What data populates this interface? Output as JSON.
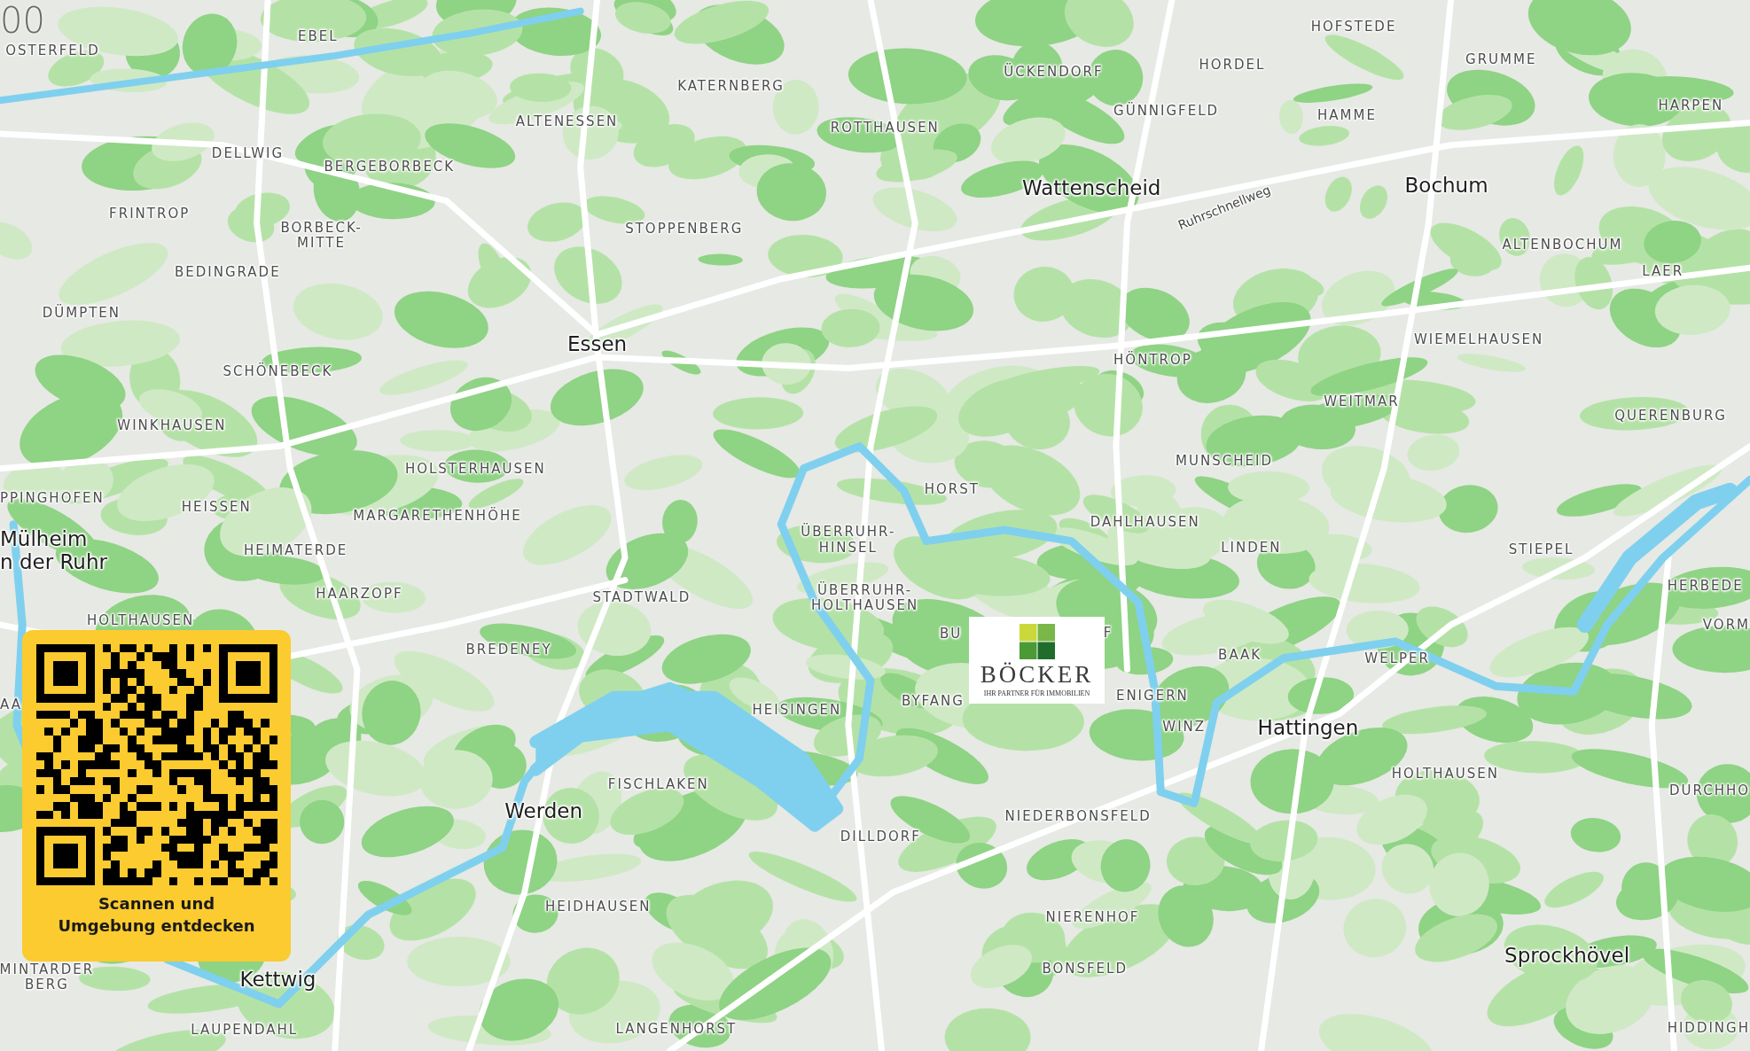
{
  "map": {
    "labels": [
      {
        "text": "00",
        "kind": "scale"
      },
      {
        "text": "OSTERFELD",
        "kind": "district"
      },
      {
        "text": "EBEL",
        "kind": "district"
      },
      {
        "text": "KATERNBERG",
        "kind": "district"
      },
      {
        "text": "ÜCKENDORF",
        "kind": "district"
      },
      {
        "text": "HORDEL",
        "kind": "district"
      },
      {
        "text": "HOFSTEDE",
        "kind": "district"
      },
      {
        "text": "GRUMME",
        "kind": "district"
      },
      {
        "text": "HARPEN",
        "kind": "district"
      },
      {
        "text": "ALTENESSEN",
        "kind": "district"
      },
      {
        "text": "ROTTHAUSEN",
        "kind": "district"
      },
      {
        "text": "GÜNNIGFELD",
        "kind": "district"
      },
      {
        "text": "HAMME",
        "kind": "district"
      },
      {
        "text": "DELLWIG",
        "kind": "district"
      },
      {
        "text": "BERGEBORBECK",
        "kind": "district"
      },
      {
        "text": "Wattenscheid",
        "kind": "city"
      },
      {
        "text": "Bochum",
        "kind": "city"
      },
      {
        "text": "Ruhrschnellweg",
        "kind": "road"
      },
      {
        "text": "FRINTROP",
        "kind": "district"
      },
      {
        "text": "BORBECK-\nMITTE",
        "kind": "district"
      },
      {
        "text": "STOPPENBERG",
        "kind": "district"
      },
      {
        "text": "ALTENBOCHUM",
        "kind": "district"
      },
      {
        "text": "BEDINGRADE",
        "kind": "district"
      },
      {
        "text": "LAER",
        "kind": "district"
      },
      {
        "text": "DÜMPTEN",
        "kind": "district"
      },
      {
        "text": "Essen",
        "kind": "city"
      },
      {
        "text": "WIEMELHAUSEN",
        "kind": "district"
      },
      {
        "text": "SCHÖNEBECK",
        "kind": "district"
      },
      {
        "text": "HÖNTROP",
        "kind": "district"
      },
      {
        "text": "WEITMAR",
        "kind": "district"
      },
      {
        "text": "QUERENBURG",
        "kind": "district"
      },
      {
        "text": "WINKHAUSEN",
        "kind": "district"
      },
      {
        "text": "MUNSCHEID",
        "kind": "district"
      },
      {
        "text": "HOLSTERHAUSEN",
        "kind": "district"
      },
      {
        "text": "HORST",
        "kind": "district"
      },
      {
        "text": "PPINGHOFEN",
        "kind": "district"
      },
      {
        "text": "HEISSEN",
        "kind": "district"
      },
      {
        "text": "MARGARETHENHÖHE",
        "kind": "district"
      },
      {
        "text": "DAHLHAUSEN",
        "kind": "district"
      },
      {
        "text": "Mülheim\nn der Ruhr",
        "kind": "city"
      },
      {
        "text": "HEIMATERDE",
        "kind": "district"
      },
      {
        "text": "ÜBERRUHR-\nHINSEL",
        "kind": "district"
      },
      {
        "text": "LINDEN",
        "kind": "district"
      },
      {
        "text": "STIEPEL",
        "kind": "district"
      },
      {
        "text": "HERBEDE",
        "kind": "district"
      },
      {
        "text": "HAARZOPF",
        "kind": "district"
      },
      {
        "text": "STADTWALD",
        "kind": "district"
      },
      {
        "text": "ÜBERRUHR-\nHOLTHAUSEN",
        "kind": "district"
      },
      {
        "text": "HOLTHAUSEN",
        "kind": "district"
      },
      {
        "text": "VORM",
        "kind": "district"
      },
      {
        "text": "BREDENEY",
        "kind": "district"
      },
      {
        "text": "BAAK",
        "kind": "district"
      },
      {
        "text": "WELPER",
        "kind": "district"
      },
      {
        "text": "BU",
        "kind": "district"
      },
      {
        "text": "F",
        "kind": "district"
      },
      {
        "text": "AA",
        "kind": "district"
      },
      {
        "text": "HEISINGEN",
        "kind": "district"
      },
      {
        "text": "BYFANG",
        "kind": "district"
      },
      {
        "text": "ENIGERN",
        "kind": "district"
      },
      {
        "text": "WINZ",
        "kind": "district"
      },
      {
        "text": "Hattingen",
        "kind": "city"
      },
      {
        "text": "HOLTHAUSEN",
        "kind": "district"
      },
      {
        "text": "DURCHHO",
        "kind": "district"
      },
      {
        "text": "FISCHLAKEN",
        "kind": "district"
      },
      {
        "text": "Werden",
        "kind": "city"
      },
      {
        "text": "NIEDERBONSFELD",
        "kind": "district"
      },
      {
        "text": "DILLDORF",
        "kind": "district"
      },
      {
        "text": "HEIDHAUSEN",
        "kind": "district"
      },
      {
        "text": "NIERENHOF",
        "kind": "district"
      },
      {
        "text": "Sprockhövel",
        "kind": "city"
      },
      {
        "text": "MINTARDER\nBERG",
        "kind": "district"
      },
      {
        "text": "BONSFELD",
        "kind": "district"
      },
      {
        "text": "Kettwig",
        "kind": "city"
      },
      {
        "text": "LAUPENDAHL",
        "kind": "district"
      },
      {
        "text": "LANGENHORST",
        "kind": "district"
      },
      {
        "text": "HIDDINGH",
        "kind": "district"
      }
    ]
  },
  "logo": {
    "wordmark": "BÖCKER",
    "tagline": "IHR PARTNER FÜR IMMOBILIEN"
  },
  "qr_card": {
    "caption": "Scannen und Umgebung entdecken"
  }
}
